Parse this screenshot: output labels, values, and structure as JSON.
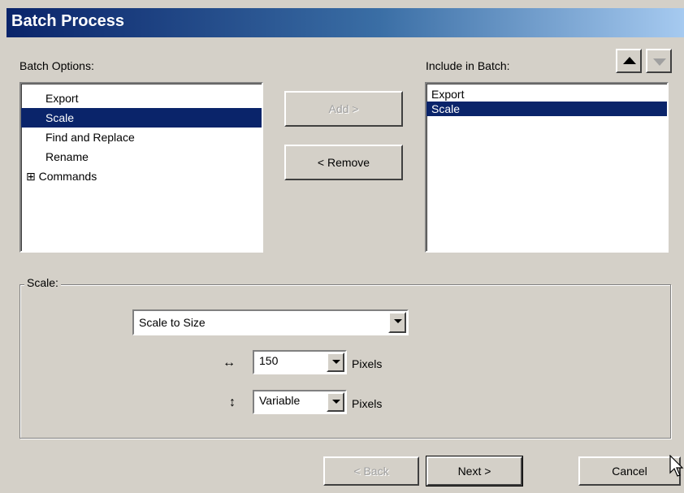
{
  "window": {
    "title": "Batch Process"
  },
  "batch_options": {
    "label": "Batch Options:",
    "items": [
      {
        "label": "Export",
        "selected": false
      },
      {
        "label": "Scale",
        "selected": true
      },
      {
        "label": "Find and Replace",
        "selected": false
      },
      {
        "label": "Rename",
        "selected": false
      },
      {
        "label": "Commands",
        "selected": false,
        "expander": "⊞"
      }
    ]
  },
  "middle_buttons": {
    "add": "Add >",
    "remove": "< Remove"
  },
  "include_in_batch": {
    "label": "Include in Batch:",
    "items": [
      {
        "label": "Export",
        "selected": false
      },
      {
        "label": "Scale",
        "selected": true
      }
    ]
  },
  "scale_group": {
    "label": "Scale:",
    "mode": "Scale to Size",
    "width_value": "150",
    "width_unit": "Pixels",
    "height_value": "Variable",
    "height_unit": "Pixels",
    "width_symbol": "↔",
    "height_symbol": "↕"
  },
  "footer": {
    "back": "< Back",
    "next": "Next >",
    "cancel": "Cancel"
  }
}
